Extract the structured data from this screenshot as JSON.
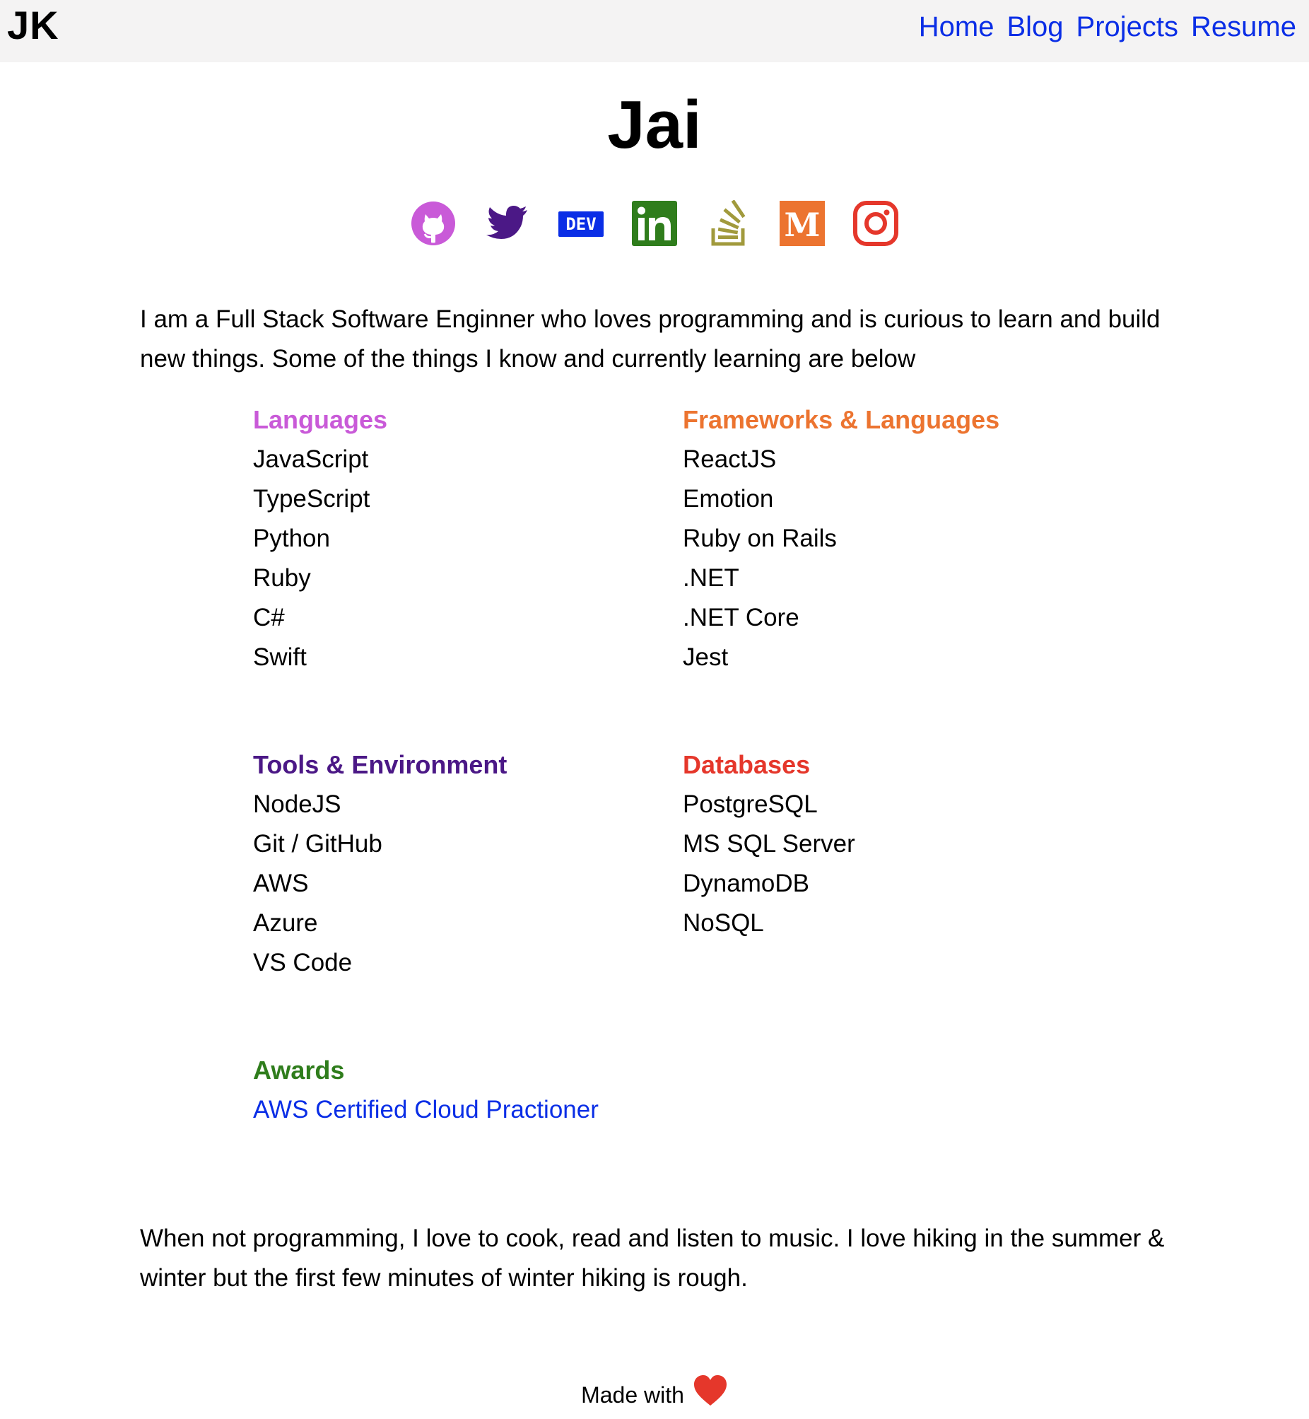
{
  "header": {
    "logo": "JK",
    "nav": [
      "Home",
      "Blog",
      "Projects",
      "Resume"
    ],
    "link_color": "#0a2ee6",
    "background": "#f4f3f3"
  },
  "name": "Jai",
  "socials": [
    {
      "icon": "github-icon",
      "color": "#c95ad8"
    },
    {
      "icon": "twitter-icon",
      "color": "#4b1886"
    },
    {
      "icon": "dev-icon",
      "color": "#0a2ee6",
      "text": "DEV"
    },
    {
      "icon": "linkedin-icon",
      "color": "#2f7d1c",
      "text": "in"
    },
    {
      "icon": "stackoverflow-icon",
      "color": "#a19a3c"
    },
    {
      "icon": "medium-icon",
      "color": "#ec7430",
      "text": "M"
    },
    {
      "icon": "instagram-icon",
      "color": "#e5372b"
    }
  ],
  "intro": "I am a Full Stack Software Enginner who loves programming and is curious to learn and build new things. Some of the things I know and currently learning are below",
  "skills": {
    "languages": {
      "title": "Languages",
      "color": "#c95ad8",
      "items": [
        "JavaScript",
        "TypeScript",
        "Python",
        "Ruby",
        "C#",
        "Swift"
      ]
    },
    "frameworks": {
      "title": "Frameworks & Languages",
      "color": "#ec7430",
      "items": [
        "ReactJS",
        "Emotion",
        "Ruby on Rails",
        ".NET",
        ".NET Core",
        "Jest"
      ]
    },
    "tools": {
      "title": "Tools & Environment",
      "color": "#4b1886",
      "items": [
        "NodeJS",
        "Git / GitHub",
        "AWS",
        "Azure",
        "VS Code"
      ]
    },
    "databases": {
      "title": "Databases",
      "color": "#e5372b",
      "items": [
        "PostgreSQL",
        "MS SQL Server",
        "DynamoDB",
        "NoSQL"
      ]
    },
    "awards": {
      "title": "Awards",
      "color": "#2f7d1c",
      "items": [
        "AWS Certified Cloud Practioner"
      ]
    }
  },
  "outro": "When not programming, I love to cook, read and listen to music. I love hiking in the summer & winter but the first few minutes of winter hiking is rough.",
  "footer": {
    "text": "Made with",
    "heart_color": "#e5372b"
  }
}
